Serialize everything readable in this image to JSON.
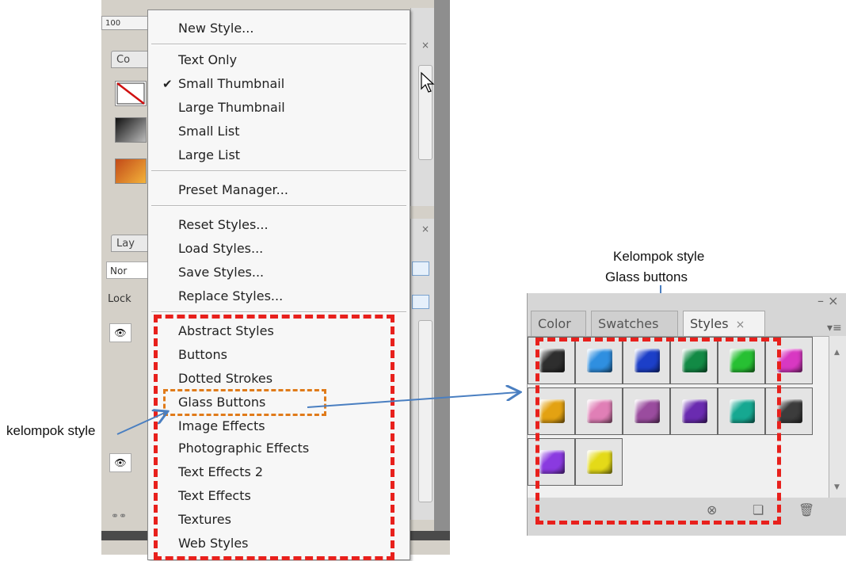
{
  "left_panel": {
    "zoom_field": "100",
    "tab_color": "Co",
    "tab_layers": "Lay",
    "blend_field": "Nor",
    "lock_label": "Lock",
    "eye_icon": "eye-icon",
    "chain_icon": "chain-icon"
  },
  "menu": {
    "new_style": "New Style...",
    "view_items": [
      {
        "label": "Text Only",
        "checked": false
      },
      {
        "label": "Small Thumbnail",
        "checked": true
      },
      {
        "label": "Large Thumbnail",
        "checked": false
      },
      {
        "label": "Small List",
        "checked": false
      },
      {
        "label": "Large List",
        "checked": false
      }
    ],
    "check_mark": "✔",
    "preset_manager": "Preset Manager...",
    "file_items": [
      "Reset Styles...",
      "Load Styles...",
      "Save Styles...",
      "Replace Styles..."
    ],
    "library_items": [
      "Abstract Styles",
      "Buttons",
      "Dotted Strokes",
      "Glass Buttons",
      "Image Effects",
      "Photographic Effects",
      "Text Effects 2",
      "Text Effects",
      "Textures",
      "Web Styles"
    ]
  },
  "annotations": {
    "left_note": "kelompok style",
    "right_note_line1": "Kelompok style",
    "right_note_line2": "Glass buttons",
    "highlight_color": "#e8201c",
    "highlight_item_color": "#e07b1a",
    "arrow_color": "#4a7fc1"
  },
  "styles_panel": {
    "tabs": [
      "Color",
      "Swatches",
      "Styles"
    ],
    "active_tab": "Styles",
    "close_glyph": "×",
    "window_controls": "– ×",
    "swatch_colors": [
      "#2e2e2e",
      "#2f8fe0",
      "#1c3fc8",
      "#128a45",
      "#27c033",
      "#d838c2",
      "#e3a212",
      "#e07fb6",
      "#9a4c9e",
      "#6a2bb0",
      "#16a891",
      "#3c3c3c",
      "#8a3ae0",
      "#e4da18"
    ],
    "bottom_icons": [
      "new-style-icon",
      "trash-icon"
    ]
  }
}
